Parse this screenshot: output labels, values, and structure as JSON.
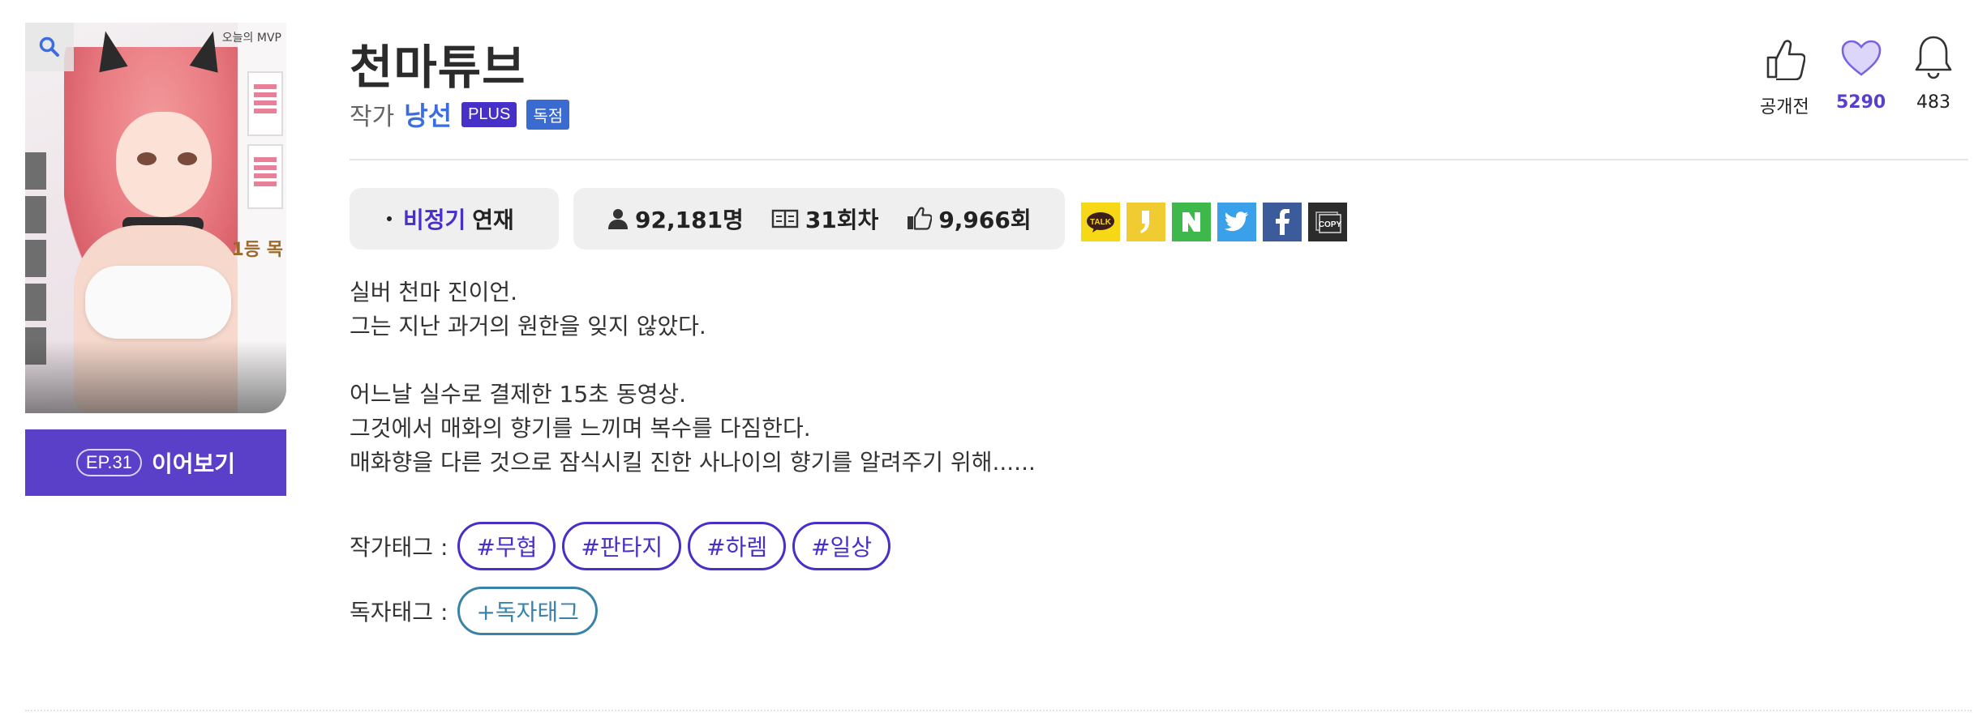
{
  "title": "천마튜브",
  "author": {
    "prefix": "작가",
    "name": "낭선",
    "badges": [
      "PLUS",
      "독점"
    ]
  },
  "cover": {
    "corner_text": "오늘의 MVP",
    "rank_text": "1등 목"
  },
  "continue": {
    "episode": "EP.31",
    "label": "이어보기"
  },
  "actions": {
    "like": {
      "icon": "thumbs-up-icon",
      "value": "공개전"
    },
    "favorite": {
      "icon": "heart-icon",
      "value": "5290"
    },
    "notify": {
      "icon": "bell-icon",
      "value": "483"
    }
  },
  "schedule": {
    "type": "비정기",
    "status": "연재"
  },
  "stats": {
    "views": "92,181명",
    "episodes": "31회차",
    "recommends": "9,966회"
  },
  "share": [
    {
      "name": "kakaotalk",
      "label": "TALK"
    },
    {
      "name": "kakaostory",
      "label": ""
    },
    {
      "name": "naver",
      "label": "N"
    },
    {
      "name": "twitter",
      "label": ""
    },
    {
      "name": "facebook",
      "label": "f"
    },
    {
      "name": "copy",
      "label": "COPY"
    }
  ],
  "description": [
    "실버 천마 진이언.",
    "그는 지난 과거의 원한을 잊지 않았다.",
    "",
    "어느날 실수로 결제한 15초 동영상.",
    "그것에서 매화의 향기를 느끼며 복수를 다짐한다.",
    "매화향을 다른 것으로 잠식시킬 진한 사나이의 향기를 알려주기 위해......"
  ],
  "tags": {
    "author_label": "작가태그 :",
    "author_tags": [
      "#무협",
      "#판타지",
      "#하렘",
      "#일상"
    ],
    "reader_label": "독자태그 :",
    "reader_add": "+독자태그"
  },
  "colors": {
    "accent": "#4730c7",
    "button": "#5a3fc9",
    "author_link": "#3b6de0",
    "reader_tag": "#3a82a8"
  }
}
